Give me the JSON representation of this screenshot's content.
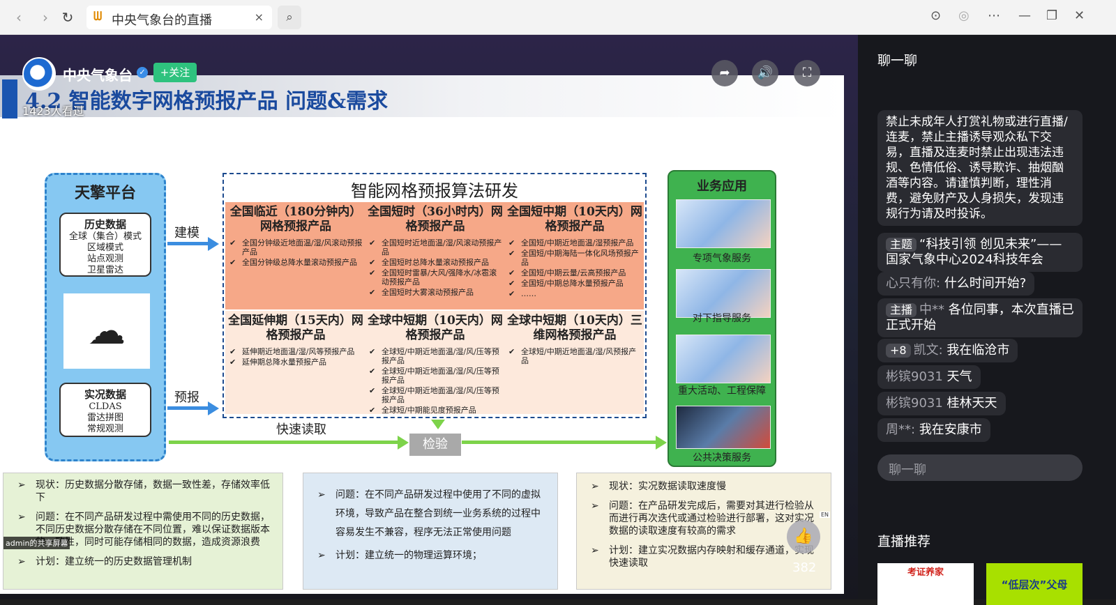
{
  "browser": {
    "tab_title": "中央气象台的直播",
    "tab_close": "×"
  },
  "slide": {
    "title": "4.2  智能数字网格预报产品 问题&需求",
    "platform": {
      "heading": "天擎平台",
      "history": {
        "title": "历史数据",
        "lines": [
          "全球（集合）模式",
          "区域模式",
          "站点观测",
          "卫星雷达"
        ]
      },
      "realtime": {
        "title": "实况数据",
        "lines": [
          "CLDAS",
          "雷达拼图",
          "常规观测"
        ]
      }
    },
    "labels": {
      "model": "建模",
      "forecast": "预报",
      "fast_read": "快速读取",
      "check": "检验"
    },
    "algo": {
      "heading": "智能网格预报算法研发",
      "cells": [
        {
          "title": "全国临近（180分钟内）网格预报产品",
          "items": [
            "全国分钟级近地面温/湿/风滚动预报产品",
            "全国分钟级总降水量滚动预报产品"
          ]
        },
        {
          "title": "全国短时（36小时内）网格预报产品",
          "items": [
            "全国短时近地面温/湿/风滚动预报产品",
            "全国短时总降水量滚动预报产品",
            "全国短时雷暴/大风/强降水/冰雹滚动预报产品",
            "全国短时大雾滚动预报产品"
          ]
        },
        {
          "title": "全国短中期（10天内）网格预报产品",
          "items": [
            "全国短/中期近地面温/湿预报产品",
            "全国短/中期海陆一体化风场预报产品",
            "全国短/中期云量/云高预报产品",
            "全国短/中期总降水量预报产品",
            "……"
          ]
        },
        {
          "title": "全国延伸期（15天内）网格预报产品",
          "items": [
            "延伸期近地面温/湿/风等预报产品",
            "延伸期总降水量预报产品"
          ]
        },
        {
          "title": "全球中短期（10天内）网格预报产品",
          "items": [
            "全球短/中期近地面温/湿/风/压等预报产品",
            "全球短/中期近地面温/湿/风/压等预报产品",
            "全球短/中期近地面温/湿/风/压等预报产品",
            "全球短/中期能见度预报产品"
          ]
        },
        {
          "title": "全球中短期（10天内）三维网格预报产品",
          "items": [
            "全球短/中期近地面温/湿/风预报产品"
          ]
        }
      ]
    },
    "business": {
      "heading": "业务应用",
      "items": [
        "专项气象服务",
        "对下指导服务",
        "重大活动、工程保障",
        "公共决策服务"
      ]
    },
    "notes": [
      [
        "现状：历史数据分散存储，数据一致性差，存储效率低下",
        "问题：在不同产品研发过程中需使用不同的历史数据，不同历史数据分散存储在不同位置，难以保证数据版本的一致性，同时可能存储相同的数据，造成资源浪费",
        "计划：建立统一的历史数据管理机制"
      ],
      [
        "问题：在不同产品研发过程中使用了不同的虚拟环境，导致产品在整合到统一业务系统的过程中容易发生不兼容，程序无法正常使用问题",
        "计划：建立统一的物理运算环境；"
      ],
      [
        "现状：实况数据读取速度慢",
        "问题：在产品研发完成后，需要对其进行检验从而进行再次迭代或通过检验进行部署，这对实况数据的读取速度有较高的需求",
        "计划：建立实况数据内存映射和缓存通道，实现快速读取"
      ]
    ]
  },
  "overlay": {
    "channel": "中央气象台",
    "verified": "✓",
    "follow": "+关注",
    "views": "1423人看过",
    "share_label": "admin的共享屏幕",
    "likes": "382",
    "en": "EN"
  },
  "chat": {
    "heading": "聊一聊",
    "notice": "禁止未成年人打赏礼物或进行直播/连麦，禁止主播诱导观众私下交易，直播及连麦时禁止出现违法违规、色情低俗、诱导欺诈、抽烟酗酒等内容。请谨慎判断，理性消费，避免财产及人身损失，发现违规行为请及时投诉。",
    "topic_tag": "主题",
    "topic": "“科技引领 创见未来”——国家气象中心2024科技年会",
    "messages": [
      {
        "tag": "",
        "user": "心只有你:",
        "text": "什么时间开始?"
      },
      {
        "tag": "主播",
        "user": "中**",
        "text": "各位同事，本次直播已正式开始"
      },
      {
        "tag": "+8",
        "user": "凯文:",
        "text": "我在临沧市"
      },
      {
        "tag": "",
        "user": "彬镔9031",
        "text": "天气"
      },
      {
        "tag": "",
        "user": "彬镔9031",
        "text": "桂林天天"
      },
      {
        "tag": "",
        "user": "周**:",
        "text": "我在安康市"
      }
    ],
    "input_placeholder": "聊一聊",
    "recommend": "直播推荐",
    "rec_cards": [
      "考证养家",
      "“低层次”父母"
    ]
  },
  "colors": {
    "accent_green": "#2ec27e",
    "slide_title": "#1a4a9e",
    "algo_top": "#f6a888",
    "algo_bottom": "#fde9dc",
    "biz_green": "#3fb24f"
  }
}
